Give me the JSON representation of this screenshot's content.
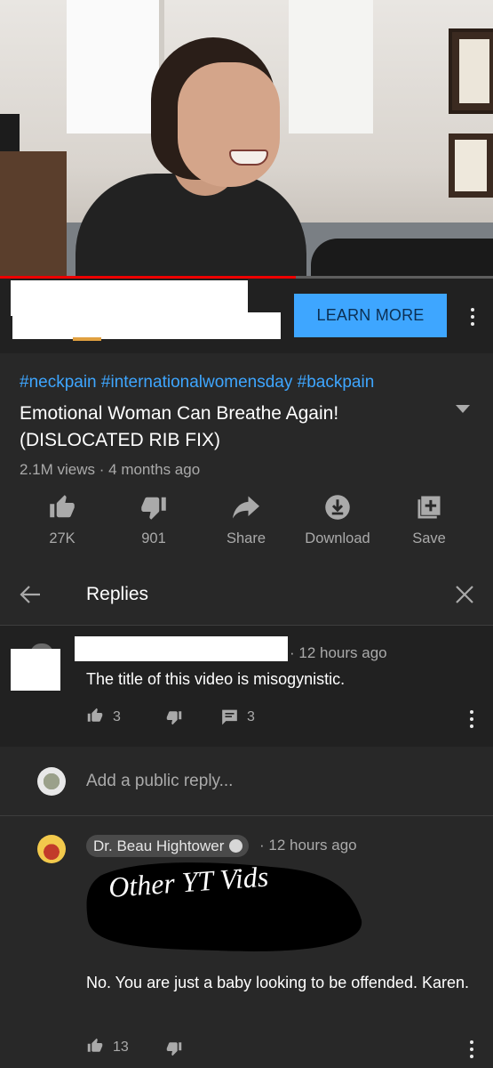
{
  "ad": {
    "cta_label": "LEARN MORE"
  },
  "video": {
    "hashtags": "#neckpain #internationalwomensday #backpain",
    "title": "Emotional Woman Can Breathe Again! (DISLOCATED RIB FIX)",
    "views": "2.1M views",
    "age": "4 months ago",
    "progress_fraction": 0.6
  },
  "actions": [
    {
      "label": "27K",
      "icon": "thumbs-up-icon"
    },
    {
      "label": "901",
      "icon": "thumbs-down-icon"
    },
    {
      "label": "Share",
      "icon": "share-icon"
    },
    {
      "label": "Download",
      "icon": "download-icon"
    },
    {
      "label": "Save",
      "icon": "add-to-playlist-icon"
    }
  ],
  "replies_panel": {
    "title": "Replies"
  },
  "parent_comment": {
    "time": "12 hours ago",
    "text": "The title of this video is misogynistic.",
    "likes": "3",
    "replies": "3"
  },
  "reply_box": {
    "placeholder": "Add a public reply..."
  },
  "reply": {
    "author": "Dr. Beau Hightower",
    "time": "12 hours ago",
    "text": "No. You are just a baby looking to be offended. Karen.",
    "likes": "13",
    "scribble_text": "Other YT Vids"
  },
  "colors": {
    "accent": "#3ea6ff",
    "progress": "#ff0000",
    "background": "#282828"
  }
}
